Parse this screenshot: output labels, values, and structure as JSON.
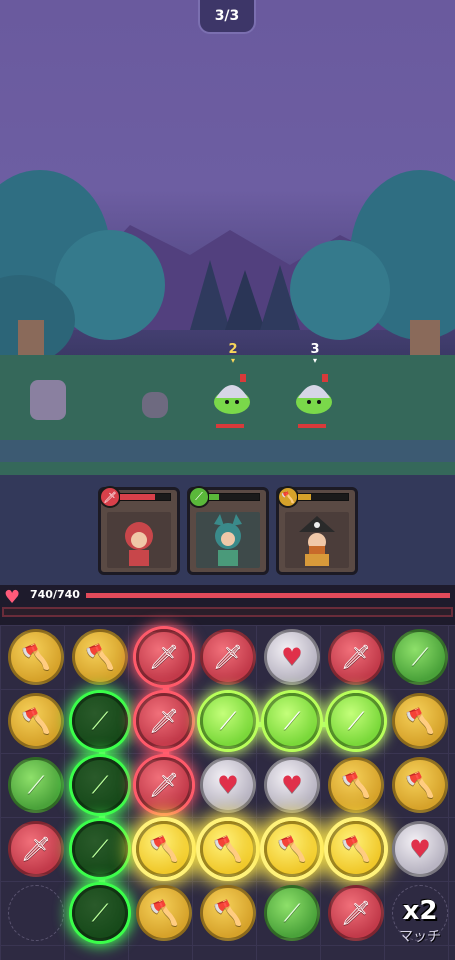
{
  "hud": {
    "wave": "3/3"
  },
  "enemies": [
    {
      "turns": "2",
      "name": "helmet-slime"
    },
    {
      "turns": "3",
      "name": "helmet-slime"
    }
  ],
  "heroes": [
    {
      "type": "sword",
      "color": "#d8404a",
      "gauge": 0.7
    },
    {
      "type": "spear",
      "color": "#5ab83a",
      "gauge": 0.2
    },
    {
      "type": "axe",
      "color": "#d6a22a",
      "gauge": 0.25
    }
  ],
  "player": {
    "hp_text": "740/740",
    "hp_fraction": 1.0
  },
  "board": {
    "rows": [
      [
        "axe",
        "axe",
        "sword",
        "sword",
        "heart",
        "sword",
        "spear"
      ],
      [
        "axe",
        "spear",
        "sword",
        "spear",
        "spear",
        "spear",
        "axe"
      ],
      [
        "spear",
        "spear",
        "sword",
        "heart",
        "heart",
        "axe",
        "axe"
      ],
      [
        "sword",
        "spear",
        "axe",
        "axe",
        "axe",
        "axe",
        "heart"
      ],
      [
        "empty",
        "spear",
        "axe",
        "axe",
        "spear",
        "sword",
        "empty"
      ]
    ],
    "icons": {
      "axe": "🪓",
      "sword": "🗡",
      "heart": "♥",
      "spear": "⟋",
      "empty": ""
    }
  },
  "combo": {
    "multiplier": "x2",
    "label": "マッチ"
  }
}
